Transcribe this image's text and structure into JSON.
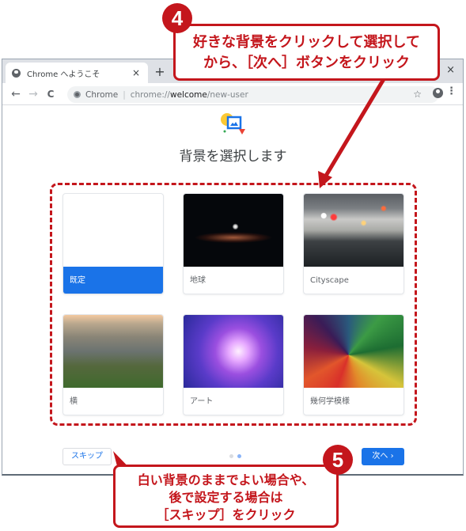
{
  "browser": {
    "tab_title": "Chrome へようこそ",
    "tab_close": "×",
    "new_tab": "+",
    "window_close": "×",
    "back": "←",
    "forward": "→",
    "reload": "C",
    "omnibox_site": "Chrome",
    "omnibox_url_prefix": "chrome://",
    "omnibox_url_host": "welcome",
    "omnibox_url_path": "/new-user",
    "bookmark_star": "☆",
    "menu": "⋮"
  },
  "page": {
    "title": "背景を選択します",
    "backgrounds": [
      {
        "label": "既定",
        "selected": true
      },
      {
        "label": "地球",
        "selected": false
      },
      {
        "label": "Cityscape",
        "selected": false
      },
      {
        "label": "横",
        "selected": false
      },
      {
        "label": "アート",
        "selected": false
      },
      {
        "label": "幾何学模様",
        "selected": false
      }
    ],
    "skip_label": "スキップ",
    "next_label": "次へ",
    "next_chevron": "›",
    "pager": {
      "total": 2,
      "current": 2
    }
  },
  "annotations": {
    "step4_number": "4",
    "step4_line1": "好きな背景をクリックして選択して",
    "step4_line2": "から、［次へ］ボタンをクリック",
    "step5_number": "5",
    "step5_line1": "白い背景のままでよい場合や、",
    "step5_line2": "後で設定する場合は",
    "step5_line3": "［スキップ］をクリック",
    "accent_color": "#c4161c"
  }
}
